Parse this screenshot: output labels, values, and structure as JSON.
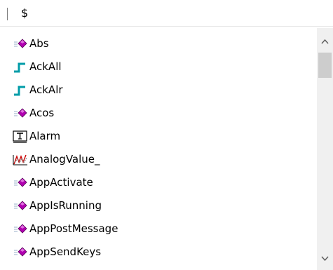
{
  "input": {
    "value": "$"
  },
  "items": [
    {
      "label": "Abs",
      "icon": "method-gem-icon"
    },
    {
      "label": "AckAll",
      "icon": "step-signal-icon"
    },
    {
      "label": "AckAlr",
      "icon": "step-signal-icon"
    },
    {
      "label": "Acos",
      "icon": "method-gem-icon"
    },
    {
      "label": "Alarm",
      "icon": "text-tag-icon"
    },
    {
      "label": "AnalogValue_",
      "icon": "analog-wave-icon"
    },
    {
      "label": "AppActivate",
      "icon": "method-gem-icon"
    },
    {
      "label": "AppIsRunning",
      "icon": "method-gem-icon"
    },
    {
      "label": "AppPostMessage",
      "icon": "method-gem-icon"
    },
    {
      "label": "AppSendKeys",
      "icon": "method-gem-icon"
    }
  ],
  "scroll": {
    "position": 0.05
  },
  "colors": {
    "gem": "#b000b0",
    "step": "#009ca8",
    "wave_red": "#cc0000"
  }
}
